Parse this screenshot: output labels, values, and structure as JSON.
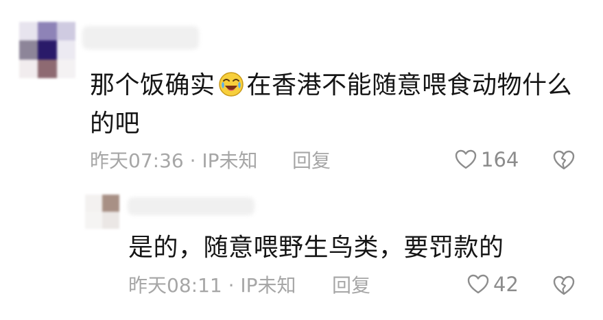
{
  "comments": [
    {
      "text_before_emoji": "那个饭确实",
      "emoji": "laughing-crying-emoji",
      "text_after_emoji": "在香港不能随意喂食动物什么的吧",
      "time": "昨天07:36 · IP未知",
      "reply_label": "回复",
      "likes": "164"
    },
    {
      "text": "是的，随意喂野生鸟类，要罚款的",
      "time": "昨天08:11 · IP未知",
      "reply_label": "回复",
      "likes": "42"
    }
  ],
  "colors": {
    "text": "#151515",
    "meta": "#a6a6a6",
    "icon": "#8c8c8c"
  }
}
